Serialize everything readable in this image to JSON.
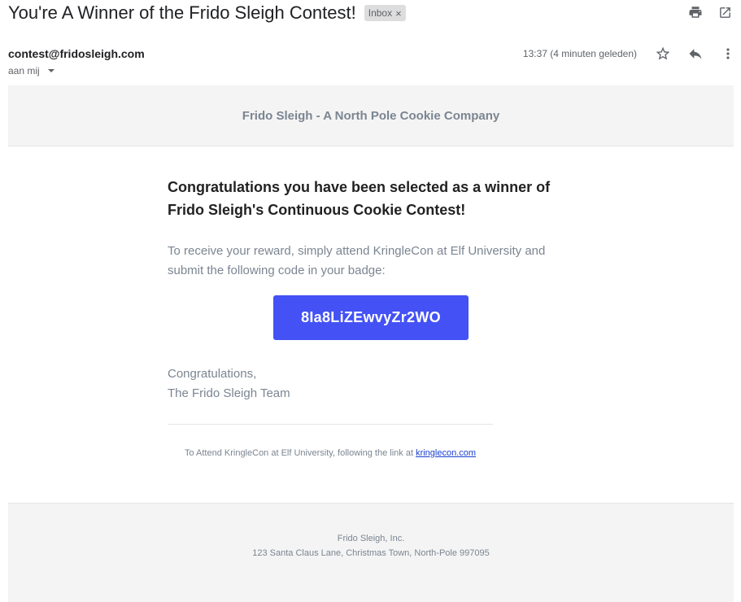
{
  "email": {
    "subject": "You're A Winner of the Frido Sleigh Contest!",
    "label_chip": "Inbox",
    "chip_remove": "×",
    "sender": "contest@fridosleigh.com",
    "recipient": "aan mij",
    "timestamp": "13:37 (4 minuten geleden)",
    "icons": [
      "print-icon",
      "open-in-new-window-icon",
      "star-icon",
      "reply-icon",
      "more-vert-icon"
    ]
  },
  "body": {
    "banner_title": "Frido Sleigh - A North Pole Cookie Company",
    "headline_line1": "Congratulations you have been selected as a winner of",
    "headline_line2": "Frido Sleigh's Continuous Cookie Contest!",
    "intro_line1": "To receive your reward, simply attend KringleCon at Elf University and",
    "intro_line2": "submit the following code in your badge:",
    "code": "8Ia8LiZEwvyZr2WO",
    "signoff_line1": "Congratulations,",
    "signoff_line2": "The Frido Sleigh Team",
    "footer_note": "To Attend KringleCon at Elf University, following the link at ",
    "footer_link": "kringlecon.com",
    "company": "Frido Sleigh, Inc.",
    "address": "123 Santa Claus Lane, Christmas Town, North-Pole 997095"
  },
  "colors": {
    "button": "#4351f5",
    "muted_text": "#7b8591",
    "banner_bg": "#f4f4f4",
    "link": "#1a3fd0"
  }
}
